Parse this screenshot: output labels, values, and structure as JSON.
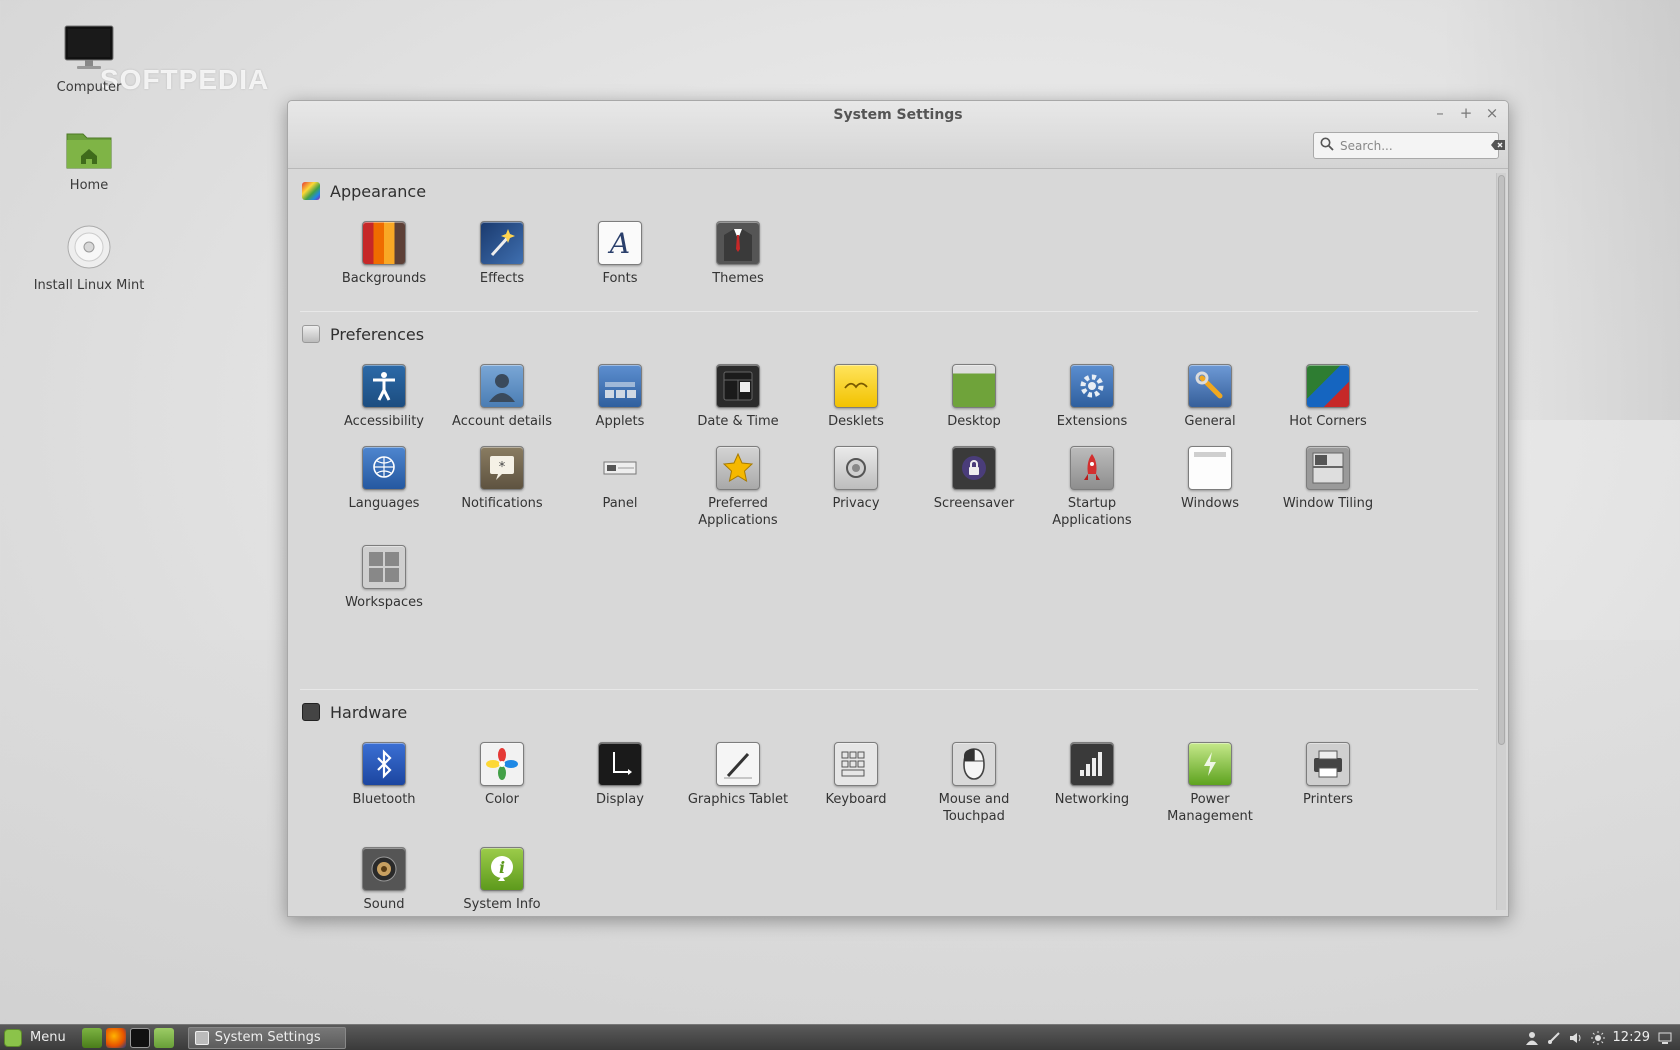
{
  "desktop": {
    "watermark": "SOFTPEDIA",
    "icons": [
      {
        "label": "Computer"
      },
      {
        "label": "Home"
      },
      {
        "label": "Install Linux Mint"
      }
    ]
  },
  "window": {
    "title": "System Settings",
    "controls": {
      "minimize": "–",
      "maximize": "+",
      "close": "×"
    },
    "search": {
      "placeholder": "Search...",
      "value": ""
    }
  },
  "sections": [
    {
      "title": "Appearance",
      "items": [
        {
          "label": "Backgrounds",
          "icon": "backgrounds-icon"
        },
        {
          "label": "Effects",
          "icon": "effects-icon"
        },
        {
          "label": "Fonts",
          "icon": "fonts-icon"
        },
        {
          "label": "Themes",
          "icon": "themes-icon"
        }
      ]
    },
    {
      "title": "Preferences",
      "items": [
        {
          "label": "Accessibility",
          "icon": "accessibility-icon"
        },
        {
          "label": "Account details",
          "icon": "account-icon"
        },
        {
          "label": "Applets",
          "icon": "applets-icon"
        },
        {
          "label": "Date & Time",
          "icon": "date-time-icon"
        },
        {
          "label": "Desklets",
          "icon": "desklets-icon"
        },
        {
          "label": "Desktop",
          "icon": "desktop-icon"
        },
        {
          "label": "Extensions",
          "icon": "extensions-icon"
        },
        {
          "label": "General",
          "icon": "general-icon"
        },
        {
          "label": "Hot Corners",
          "icon": "hot-corners-icon"
        },
        {
          "label": "Languages",
          "icon": "languages-icon"
        },
        {
          "label": "Notifications",
          "icon": "notifications-icon"
        },
        {
          "label": "Panel",
          "icon": "panel-icon"
        },
        {
          "label": "Preferred Applications",
          "icon": "preferred-apps-icon"
        },
        {
          "label": "Privacy",
          "icon": "privacy-icon"
        },
        {
          "label": "Screensaver",
          "icon": "screensaver-icon"
        },
        {
          "label": "Startup Applications",
          "icon": "startup-icon"
        },
        {
          "label": "Windows",
          "icon": "windows-icon"
        },
        {
          "label": "Window Tiling",
          "icon": "window-tiling-icon"
        },
        {
          "label": "Workspaces",
          "icon": "workspaces-icon"
        }
      ]
    },
    {
      "title": "Hardware",
      "items": [
        {
          "label": "Bluetooth",
          "icon": "bluetooth-icon"
        },
        {
          "label": "Color",
          "icon": "color-icon"
        },
        {
          "label": "Display",
          "icon": "display-icon"
        },
        {
          "label": "Graphics Tablet",
          "icon": "graphics-tablet-icon"
        },
        {
          "label": "Keyboard",
          "icon": "keyboard-icon"
        },
        {
          "label": "Mouse and Touchpad",
          "icon": "mouse-icon"
        },
        {
          "label": "Networking",
          "icon": "networking-icon"
        },
        {
          "label": "Power Management",
          "icon": "power-icon"
        },
        {
          "label": "Printers",
          "icon": "printers-icon"
        },
        {
          "label": "Sound",
          "icon": "sound-icon"
        },
        {
          "label": "System Info",
          "icon": "system-info-icon"
        }
      ]
    }
  ],
  "panel": {
    "menu_label": "Menu",
    "task_label": "System Settings",
    "clock": "12:29"
  }
}
